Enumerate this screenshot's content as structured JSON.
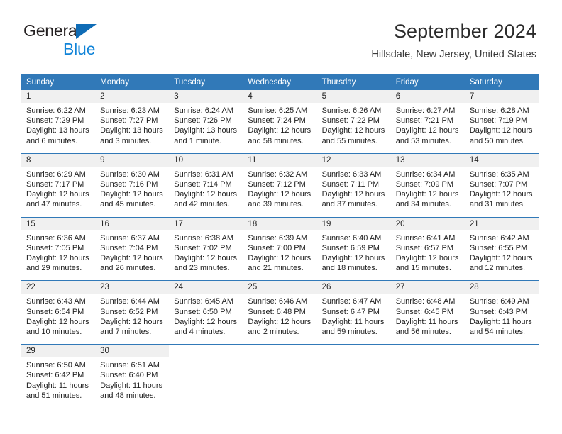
{
  "brand": {
    "name_top": "General",
    "name_bottom": "Blue",
    "accent_blue": "#1184d8",
    "triangle_blue": "#0f6cb6"
  },
  "header": {
    "title": "September 2024",
    "subtitle": "Hillsdale, New Jersey, United States",
    "header_bar_color": "#3179b8",
    "daynum_band_color": "#f0f0f0"
  },
  "weekday_headers": [
    "Sunday",
    "Monday",
    "Tuesday",
    "Wednesday",
    "Thursday",
    "Friday",
    "Saturday"
  ],
  "labels": {
    "sunrise_prefix": "Sunrise: ",
    "sunset_prefix": "Sunset: ",
    "daylight_prefix": "Daylight: "
  },
  "weeks": [
    {
      "days": [
        {
          "num": "1",
          "sunrise": "Sunrise: 6:22 AM",
          "sunset": "Sunset: 7:29 PM",
          "daylight": "Daylight: 13 hours and 6 minutes."
        },
        {
          "num": "2",
          "sunrise": "Sunrise: 6:23 AM",
          "sunset": "Sunset: 7:27 PM",
          "daylight": "Daylight: 13 hours and 3 minutes."
        },
        {
          "num": "3",
          "sunrise": "Sunrise: 6:24 AM",
          "sunset": "Sunset: 7:26 PM",
          "daylight": "Daylight: 13 hours and 1 minute."
        },
        {
          "num": "4",
          "sunrise": "Sunrise: 6:25 AM",
          "sunset": "Sunset: 7:24 PM",
          "daylight": "Daylight: 12 hours and 58 minutes."
        },
        {
          "num": "5",
          "sunrise": "Sunrise: 6:26 AM",
          "sunset": "Sunset: 7:22 PM",
          "daylight": "Daylight: 12 hours and 55 minutes."
        },
        {
          "num": "6",
          "sunrise": "Sunrise: 6:27 AM",
          "sunset": "Sunset: 7:21 PM",
          "daylight": "Daylight: 12 hours and 53 minutes."
        },
        {
          "num": "7",
          "sunrise": "Sunrise: 6:28 AM",
          "sunset": "Sunset: 7:19 PM",
          "daylight": "Daylight: 12 hours and 50 minutes."
        }
      ]
    },
    {
      "days": [
        {
          "num": "8",
          "sunrise": "Sunrise: 6:29 AM",
          "sunset": "Sunset: 7:17 PM",
          "daylight": "Daylight: 12 hours and 47 minutes."
        },
        {
          "num": "9",
          "sunrise": "Sunrise: 6:30 AM",
          "sunset": "Sunset: 7:16 PM",
          "daylight": "Daylight: 12 hours and 45 minutes."
        },
        {
          "num": "10",
          "sunrise": "Sunrise: 6:31 AM",
          "sunset": "Sunset: 7:14 PM",
          "daylight": "Daylight: 12 hours and 42 minutes."
        },
        {
          "num": "11",
          "sunrise": "Sunrise: 6:32 AM",
          "sunset": "Sunset: 7:12 PM",
          "daylight": "Daylight: 12 hours and 39 minutes."
        },
        {
          "num": "12",
          "sunrise": "Sunrise: 6:33 AM",
          "sunset": "Sunset: 7:11 PM",
          "daylight": "Daylight: 12 hours and 37 minutes."
        },
        {
          "num": "13",
          "sunrise": "Sunrise: 6:34 AM",
          "sunset": "Sunset: 7:09 PM",
          "daylight": "Daylight: 12 hours and 34 minutes."
        },
        {
          "num": "14",
          "sunrise": "Sunrise: 6:35 AM",
          "sunset": "Sunset: 7:07 PM",
          "daylight": "Daylight: 12 hours and 31 minutes."
        }
      ]
    },
    {
      "days": [
        {
          "num": "15",
          "sunrise": "Sunrise: 6:36 AM",
          "sunset": "Sunset: 7:05 PM",
          "daylight": "Daylight: 12 hours and 29 minutes."
        },
        {
          "num": "16",
          "sunrise": "Sunrise: 6:37 AM",
          "sunset": "Sunset: 7:04 PM",
          "daylight": "Daylight: 12 hours and 26 minutes."
        },
        {
          "num": "17",
          "sunrise": "Sunrise: 6:38 AM",
          "sunset": "Sunset: 7:02 PM",
          "daylight": "Daylight: 12 hours and 23 minutes."
        },
        {
          "num": "18",
          "sunrise": "Sunrise: 6:39 AM",
          "sunset": "Sunset: 7:00 PM",
          "daylight": "Daylight: 12 hours and 21 minutes."
        },
        {
          "num": "19",
          "sunrise": "Sunrise: 6:40 AM",
          "sunset": "Sunset: 6:59 PM",
          "daylight": "Daylight: 12 hours and 18 minutes."
        },
        {
          "num": "20",
          "sunrise": "Sunrise: 6:41 AM",
          "sunset": "Sunset: 6:57 PM",
          "daylight": "Daylight: 12 hours and 15 minutes."
        },
        {
          "num": "21",
          "sunrise": "Sunrise: 6:42 AM",
          "sunset": "Sunset: 6:55 PM",
          "daylight": "Daylight: 12 hours and 12 minutes."
        }
      ]
    },
    {
      "days": [
        {
          "num": "22",
          "sunrise": "Sunrise: 6:43 AM",
          "sunset": "Sunset: 6:54 PM",
          "daylight": "Daylight: 12 hours and 10 minutes."
        },
        {
          "num": "23",
          "sunrise": "Sunrise: 6:44 AM",
          "sunset": "Sunset: 6:52 PM",
          "daylight": "Daylight: 12 hours and 7 minutes."
        },
        {
          "num": "24",
          "sunrise": "Sunrise: 6:45 AM",
          "sunset": "Sunset: 6:50 PM",
          "daylight": "Daylight: 12 hours and 4 minutes."
        },
        {
          "num": "25",
          "sunrise": "Sunrise: 6:46 AM",
          "sunset": "Sunset: 6:48 PM",
          "daylight": "Daylight: 12 hours and 2 minutes."
        },
        {
          "num": "26",
          "sunrise": "Sunrise: 6:47 AM",
          "sunset": "Sunset: 6:47 PM",
          "daylight": "Daylight: 11 hours and 59 minutes."
        },
        {
          "num": "27",
          "sunrise": "Sunrise: 6:48 AM",
          "sunset": "Sunset: 6:45 PM",
          "daylight": "Daylight: 11 hours and 56 minutes."
        },
        {
          "num": "28",
          "sunrise": "Sunrise: 6:49 AM",
          "sunset": "Sunset: 6:43 PM",
          "daylight": "Daylight: 11 hours and 54 minutes."
        }
      ]
    },
    {
      "days": [
        {
          "num": "29",
          "sunrise": "Sunrise: 6:50 AM",
          "sunset": "Sunset: 6:42 PM",
          "daylight": "Daylight: 11 hours and 51 minutes."
        },
        {
          "num": "30",
          "sunrise": "Sunrise: 6:51 AM",
          "sunset": "Sunset: 6:40 PM",
          "daylight": "Daylight: 11 hours and 48 minutes."
        },
        {
          "num": "",
          "sunrise": "",
          "sunset": "",
          "daylight": ""
        },
        {
          "num": "",
          "sunrise": "",
          "sunset": "",
          "daylight": ""
        },
        {
          "num": "",
          "sunrise": "",
          "sunset": "",
          "daylight": ""
        },
        {
          "num": "",
          "sunrise": "",
          "sunset": "",
          "daylight": ""
        },
        {
          "num": "",
          "sunrise": "",
          "sunset": "",
          "daylight": ""
        }
      ]
    }
  ]
}
